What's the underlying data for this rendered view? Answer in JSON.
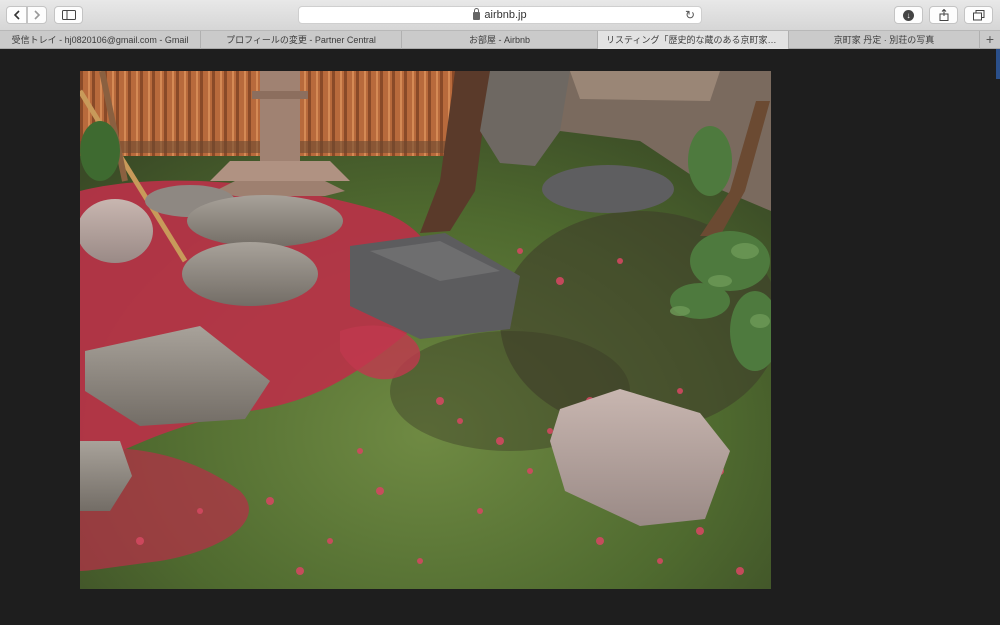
{
  "toolbar": {
    "url": "airbnb.jp",
    "back_icon": "chevron-left-icon",
    "forward_icon": "chevron-right-icon",
    "sidebar_icon": "sidebar-icon",
    "reload_icon": "reload-icon",
    "download_icon": "download-icon",
    "share_icon": "share-icon",
    "tabs_icon": "tabs-overview-icon"
  },
  "tabs": [
    {
      "label": "受信トレイ - hj0820106@gmail.com - Gmail",
      "width": 201
    },
    {
      "label": "プロフィールの変更 - Partner Central",
      "width": 201
    },
    {
      "label": "お部屋 - Airbnb",
      "width": 196
    },
    {
      "label": "リスティング「歴史的な蔵のある京町家「丹定…",
      "width": 191,
      "active": true
    },
    {
      "label": "京町家 丹定 · 別荘の写真",
      "width": 191
    }
  ],
  "new_tab_label": "+",
  "photo": {
    "subject": "Japanese garden with stepping stones and red maple leaves",
    "colors": {
      "moss": "#5f7a3a",
      "leaves": "#c23a4e",
      "stone": "#8a8580",
      "fence": "#b5683a"
    }
  }
}
